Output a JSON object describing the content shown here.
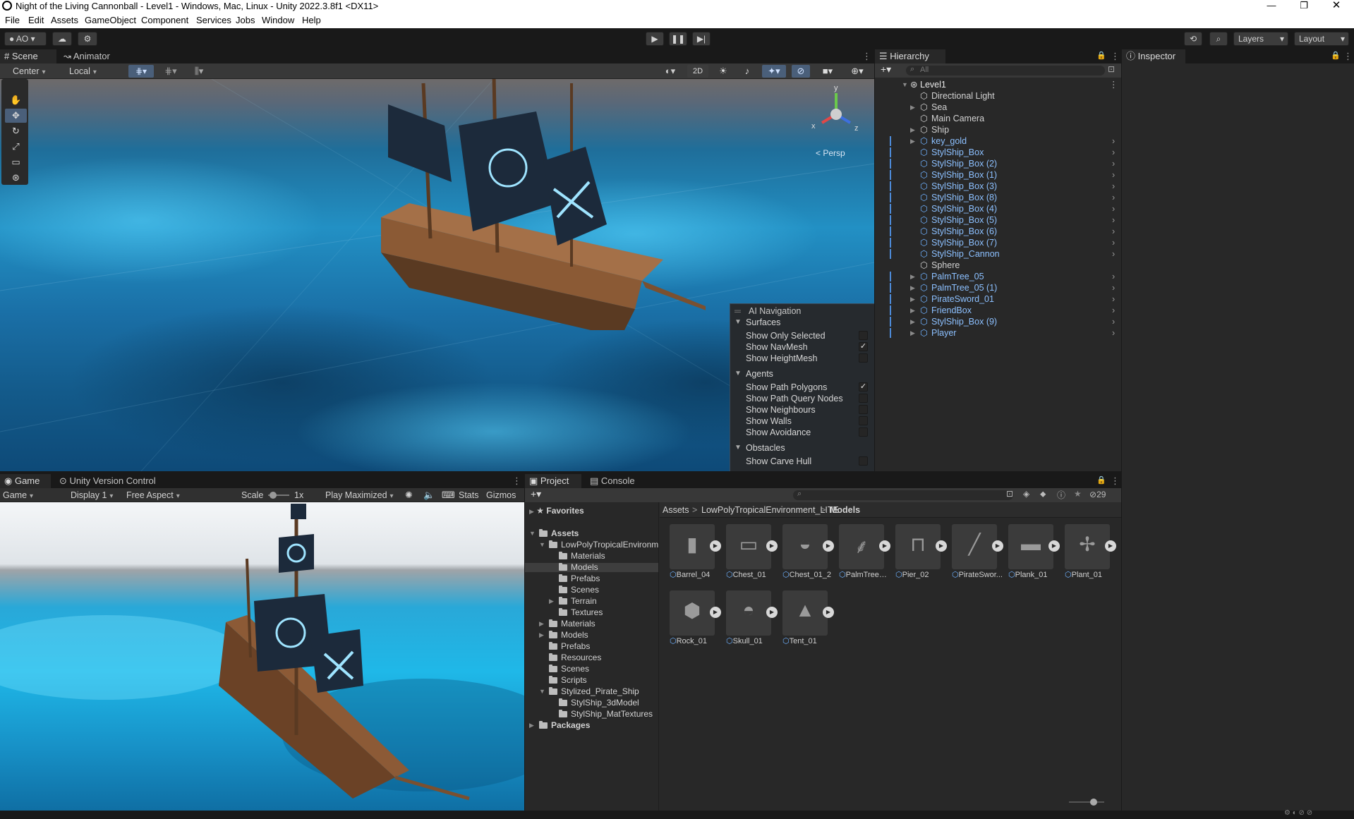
{
  "window": {
    "title": "Night of the Living Cannonball - Level1 - Windows, Mac, Linux - Unity 2022.3.8f1 <DX11>"
  },
  "menu": [
    "File",
    "Edit",
    "Assets",
    "GameObject",
    "Component",
    "Services",
    "Jobs",
    "Window",
    "Help"
  ],
  "toolbar": {
    "account": "AO",
    "layers": "Layers",
    "layout": "Layout"
  },
  "scene": {
    "tabs": [
      "Scene",
      "Animator"
    ],
    "pivot": "Center",
    "space": "Local",
    "mode2d": "2D",
    "persp": "< Persp",
    "gizmo_axes": {
      "y": "y",
      "x": "x",
      "z": "z"
    }
  },
  "ai_nav": {
    "title": "AI Navigation",
    "sections": [
      {
        "name": "Surfaces",
        "items": [
          {
            "label": "Show Only Selected",
            "checked": false
          },
          {
            "label": "Show NavMesh",
            "checked": true
          },
          {
            "label": "Show HeightMesh",
            "checked": false
          }
        ]
      },
      {
        "name": "Agents",
        "items": [
          {
            "label": "Show Path Polygons",
            "checked": true
          },
          {
            "label": "Show Path Query Nodes",
            "checked": false
          },
          {
            "label": "Show Neighbours",
            "checked": false
          },
          {
            "label": "Show Walls",
            "checked": false
          },
          {
            "label": "Show Avoidance",
            "checked": false
          }
        ]
      },
      {
        "name": "Obstacles",
        "items": [
          {
            "label": "Show Carve Hull",
            "checked": false
          }
        ]
      }
    ]
  },
  "hierarchy": {
    "tab": "Hierarchy",
    "search_placeholder": "All",
    "root": "Level1",
    "items": [
      {
        "label": "Directional Light",
        "prefab": false,
        "expandable": false
      },
      {
        "label": "Sea",
        "prefab": false,
        "expandable": true
      },
      {
        "label": "Main Camera",
        "prefab": false,
        "expandable": false
      },
      {
        "label": "Ship",
        "prefab": false,
        "expandable": true
      },
      {
        "label": "key_gold",
        "prefab": true,
        "expandable": true
      },
      {
        "label": "StylShip_Box",
        "prefab": true,
        "expandable": false
      },
      {
        "label": "StylShip_Box (2)",
        "prefab": true,
        "expandable": false
      },
      {
        "label": "StylShip_Box (1)",
        "prefab": true,
        "expandable": false
      },
      {
        "label": "StylShip_Box (3)",
        "prefab": true,
        "expandable": false
      },
      {
        "label": "StylShip_Box (8)",
        "prefab": true,
        "expandable": false
      },
      {
        "label": "StylShip_Box (4)",
        "prefab": true,
        "expandable": false
      },
      {
        "label": "StylShip_Box (5)",
        "prefab": true,
        "expandable": false
      },
      {
        "label": "StylShip_Box (6)",
        "prefab": true,
        "expandable": false
      },
      {
        "label": "StylShip_Box (7)",
        "prefab": true,
        "expandable": false
      },
      {
        "label": "StylShip_Cannon",
        "prefab": true,
        "expandable": false
      },
      {
        "label": "Sphere",
        "prefab": false,
        "expandable": false
      },
      {
        "label": "PalmTree_05",
        "prefab": true,
        "expandable": true
      },
      {
        "label": "PalmTree_05 (1)",
        "prefab": true,
        "expandable": true
      },
      {
        "label": "PirateSword_01",
        "prefab": true,
        "expandable": true
      },
      {
        "label": "FriendBox",
        "prefab": true,
        "expandable": true
      },
      {
        "label": "StylShip_Box (9)",
        "prefab": true,
        "expandable": true
      },
      {
        "label": "Player",
        "prefab": true,
        "expandable": true
      }
    ]
  },
  "inspector": {
    "tab": "Inspector"
  },
  "game": {
    "tabs": [
      "Game",
      "Unity Version Control"
    ],
    "view": "Game",
    "display": "Display 1",
    "aspect": "Free Aspect",
    "scale_label": "Scale",
    "scale_value": "1x",
    "play_mode": "Play Maximized",
    "stats": "Stats",
    "gizmos": "Gizmos"
  },
  "project": {
    "tabs": [
      "Project",
      "Console"
    ],
    "hidden_count": "29",
    "favorites": "Favorites",
    "tree": [
      {
        "label": "Assets",
        "depth": 0,
        "bold": true,
        "open": true
      },
      {
        "label": "LowPolyTropicalEnvironment_LITE",
        "depth": 1,
        "open": true
      },
      {
        "label": "Materials",
        "depth": 2
      },
      {
        "label": "Models",
        "depth": 2,
        "selected": true
      },
      {
        "label": "Prefabs",
        "depth": 2
      },
      {
        "label": "Scenes",
        "depth": 2
      },
      {
        "label": "Terrain",
        "depth": 2,
        "closed": true
      },
      {
        "label": "Textures",
        "depth": 2
      },
      {
        "label": "Materials",
        "depth": 1,
        "closed": true
      },
      {
        "label": "Models",
        "depth": 1,
        "closed": true
      },
      {
        "label": "Prefabs",
        "depth": 1
      },
      {
        "label": "Resources",
        "depth": 1
      },
      {
        "label": "Scenes",
        "depth": 1
      },
      {
        "label": "Scripts",
        "depth": 1
      },
      {
        "label": "Stylized_Pirate_Ship",
        "depth": 1,
        "open": true
      },
      {
        "label": "StylShip_3dModel",
        "depth": 2
      },
      {
        "label": "StylShip_MatTextures",
        "depth": 2
      },
      {
        "label": "Packages",
        "depth": 0,
        "bold": true,
        "closed": true
      }
    ],
    "breadcrumb": [
      "Assets",
      "LowPolyTropicalEnvironment_LITE",
      "Models"
    ],
    "assets": [
      "Barrel_04",
      "Chest_01",
      "Chest_01_2",
      "PalmTree_...",
      "Pier_02",
      "PirateSwor...",
      "Plank_01",
      "Plant_01",
      "Rock_01",
      "Skull_01",
      "Tent_01"
    ]
  },
  "colors": {
    "accent": "#4d8ad8",
    "prefab": "#8cc0ff",
    "selected_bg": "#2c5d87"
  }
}
